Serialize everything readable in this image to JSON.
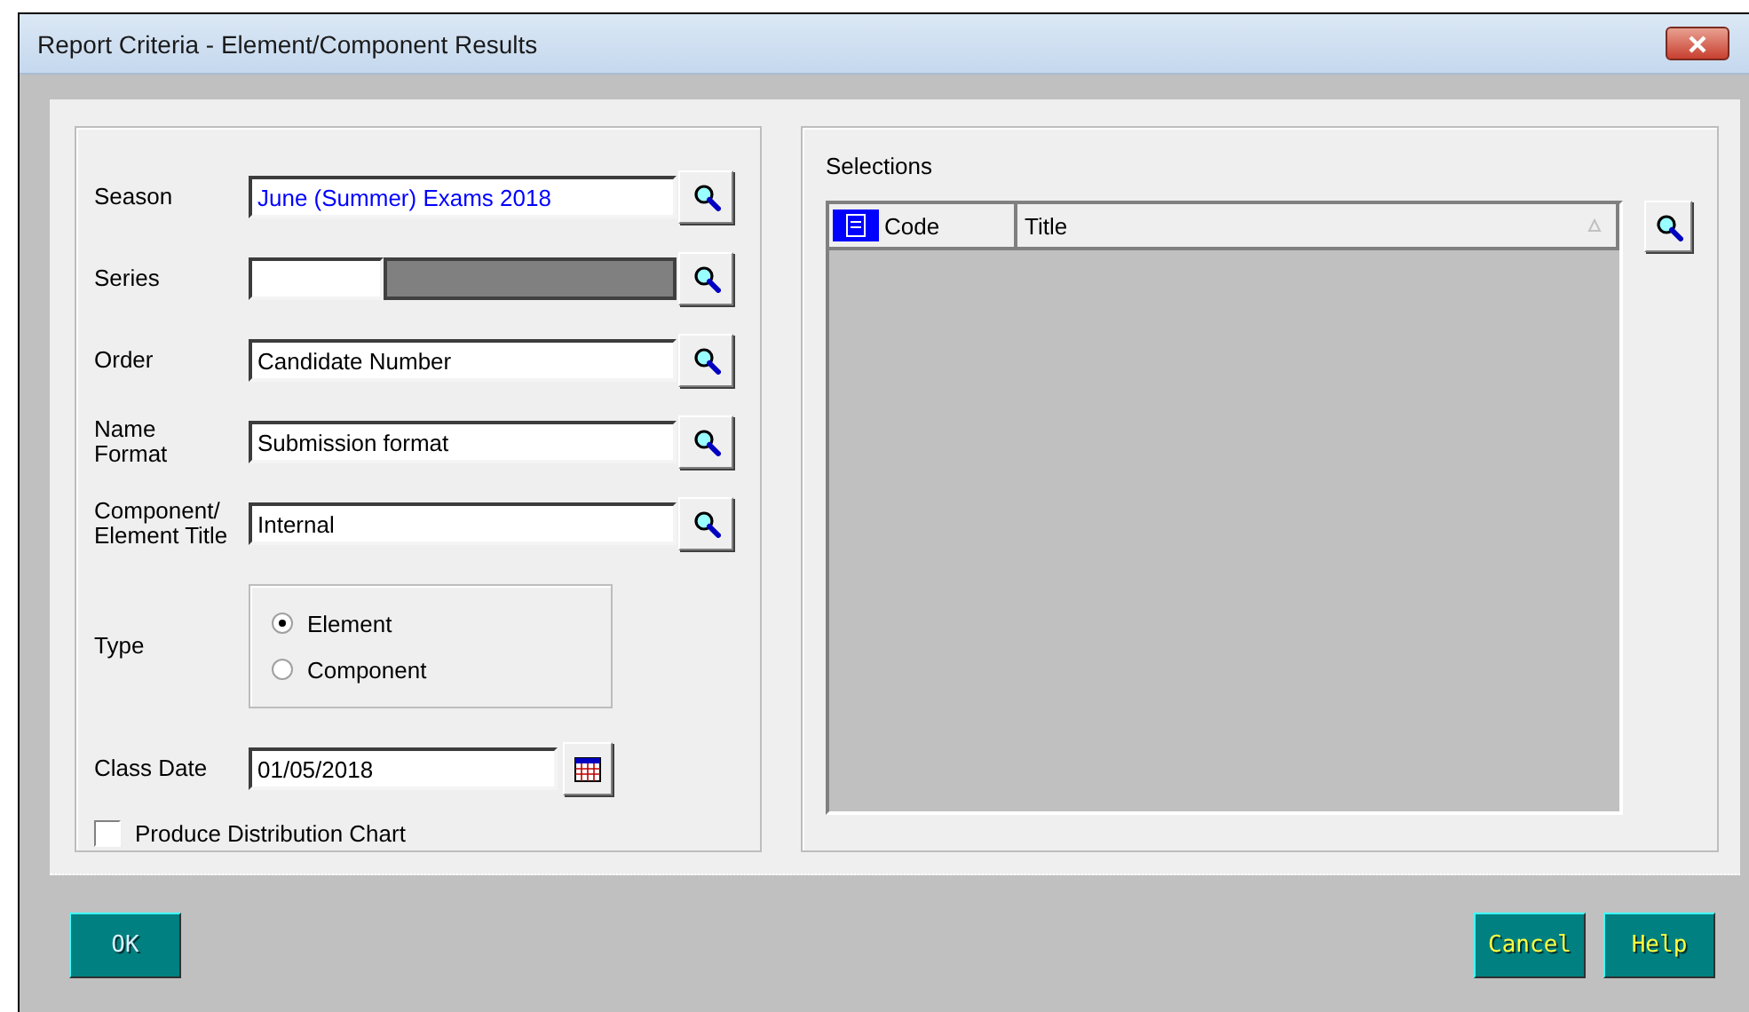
{
  "window": {
    "title": "Report Criteria - Element/Component Results"
  },
  "criteria": {
    "fields": [
      {
        "label": "Season",
        "value": "June (Summer) Exams 2018",
        "color": "#0000ff",
        "kind": "lookup"
      },
      {
        "label": "Series",
        "kind": "split"
      },
      {
        "label": "Order",
        "value": "Candidate Number",
        "color": "#000000",
        "kind": "lookup"
      },
      {
        "label": "Name Format",
        "value": "Submission format",
        "color": "#000000",
        "kind": "lookup"
      },
      {
        "label": "Component/ Element Title",
        "value": "Internal",
        "color": "#000000",
        "kind": "lookup"
      }
    ],
    "type": {
      "label": "Type",
      "options": [
        {
          "label": "Element",
          "selected": true
        },
        {
          "label": "Component",
          "selected": false
        }
      ]
    },
    "class_date": {
      "label": "Class Date",
      "value": "01/05/2018"
    },
    "distribution_chart": {
      "label": "Produce Distribution Chart",
      "checked": false
    }
  },
  "selections": {
    "title": "Selections",
    "columns": [
      {
        "label": "Code"
      },
      {
        "label": "Title"
      }
    ]
  },
  "buttons_left": [
    {
      "label": "OK",
      "default": true
    }
  ],
  "buttons_right": [
    {
      "label": "Cancel",
      "default": false
    },
    {
      "label": "Help",
      "default": false
    }
  ]
}
